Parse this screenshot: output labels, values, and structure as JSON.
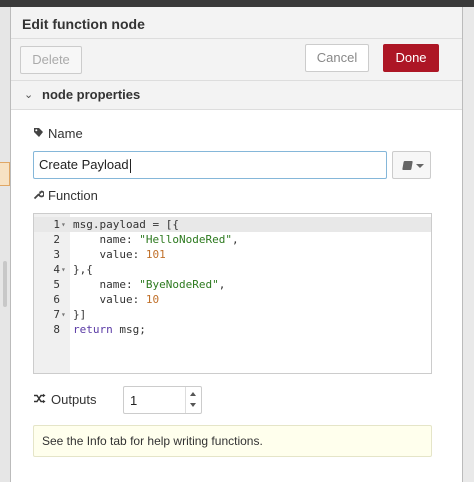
{
  "dialog": {
    "title": "Edit function node",
    "delete_label": "Delete",
    "cancel_label": "Cancel",
    "done_label": "Done",
    "done_color": "#ad1625"
  },
  "section": {
    "label": "node properties",
    "expanded": true
  },
  "name_field": {
    "label": "Name",
    "value": "Create Payload"
  },
  "function_field": {
    "label": "Function",
    "lines": [
      {
        "n": "1",
        "fold": "▾",
        "parts": [
          [
            "",
            "msg.payload = [{"
          ]
        ]
      },
      {
        "n": "2",
        "fold": "",
        "parts": [
          [
            "",
            "    name: "
          ],
          [
            "str",
            "\"HelloNodeRed\""
          ],
          [
            "",
            ","
          ]
        ]
      },
      {
        "n": "3",
        "fold": "",
        "parts": [
          [
            "",
            "    value: "
          ],
          [
            "num",
            "101"
          ]
        ]
      },
      {
        "n": "4",
        "fold": "▾",
        "parts": [
          [
            "",
            "},{"
          ]
        ]
      },
      {
        "n": "5",
        "fold": "",
        "parts": [
          [
            "",
            "    name: "
          ],
          [
            "str",
            "\"ByeNodeRed\""
          ],
          [
            "",
            ","
          ]
        ]
      },
      {
        "n": "6",
        "fold": "",
        "parts": [
          [
            "",
            "    value: "
          ],
          [
            "num",
            "10"
          ]
        ]
      },
      {
        "n": "7",
        "fold": "▾",
        "parts": [
          [
            "",
            "}]"
          ]
        ]
      },
      {
        "n": "8",
        "fold": "",
        "parts": [
          [
            "kw",
            "return"
          ],
          [
            "",
            " msg;"
          ]
        ]
      }
    ]
  },
  "outputs": {
    "label": "Outputs",
    "value": "1"
  },
  "tip": {
    "text": "See the Info tab for help writing functions."
  },
  "icons": {
    "name": "tag-icon",
    "function": "wrench-icon",
    "outputs": "random-icon",
    "library": "book-icon",
    "section": "chevron-down-icon"
  }
}
